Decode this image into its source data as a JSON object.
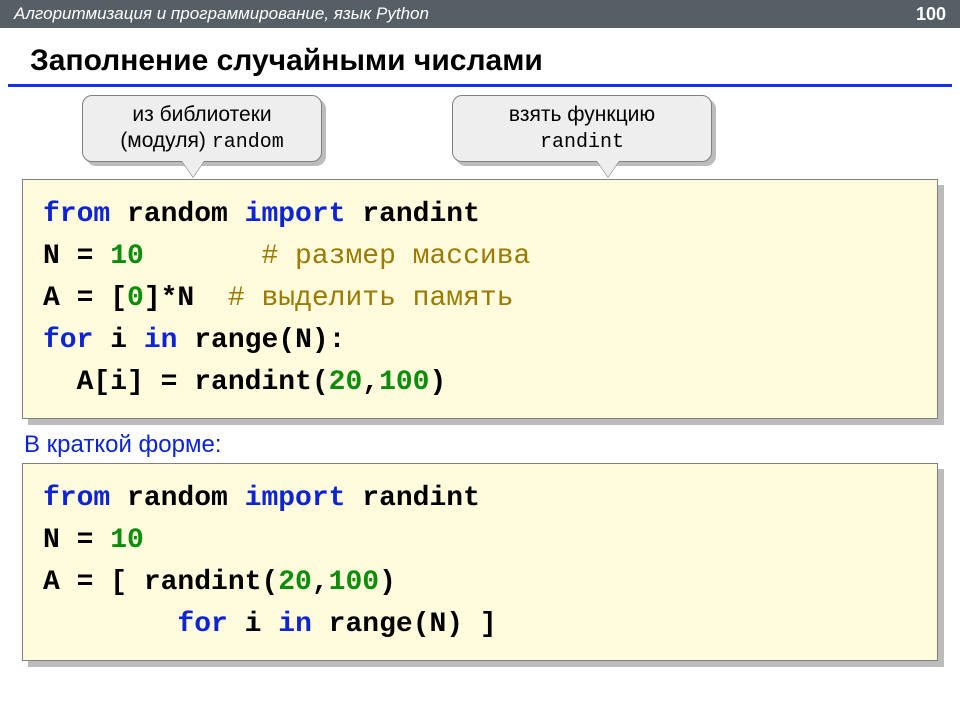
{
  "header": {
    "topic": "Алгоритмизация и программирование, язык Python",
    "pagenum": "100"
  },
  "title": "Заполнение случайными числами",
  "callouts": {
    "left_line1": "из библиотеки",
    "left_line2_a": "(модуля) ",
    "left_line2_mono": "random",
    "right_line1": "взять функцию",
    "right_line2_mono": "randint"
  },
  "code1": {
    "l1_kw1": "from",
    "l1_t1": " random ",
    "l1_kw2": "import",
    "l1_t2": " randint",
    "l2_a": "N = ",
    "l2_num": "10",
    "l2_pad": "       ",
    "l2_cmt": "# размер массива",
    "l3_a": "A = [",
    "l3_num": "0",
    "l3_b": "]*N  ",
    "l3_cmt": "# выделить память",
    "l4_kw1": "for",
    "l4_a": " i ",
    "l4_kw2": "in",
    "l4_b": " range(N):",
    "l5_pad": "  ",
    "l5_a": "A[i] = randint(",
    "l5_n1": "20",
    "l5_comma": ",",
    "l5_n2": "100",
    "l5_close": ")"
  },
  "subhead": "В краткой форме:",
  "code2": {
    "l1_kw1": "from",
    "l1_t1": " random ",
    "l1_kw2": "import",
    "l1_t2": " randint",
    "l2_a": "N = ",
    "l2_num": "10",
    "l3_a": "A = [ randint(",
    "l3_n1": "20",
    "l3_comma": ",",
    "l3_n2": "100",
    "l3_close": ") ",
    "l4_pad": "        ",
    "l4_kw1": "for",
    "l4_a": " i ",
    "l4_kw2": "in",
    "l4_b": " range(N) ]"
  }
}
